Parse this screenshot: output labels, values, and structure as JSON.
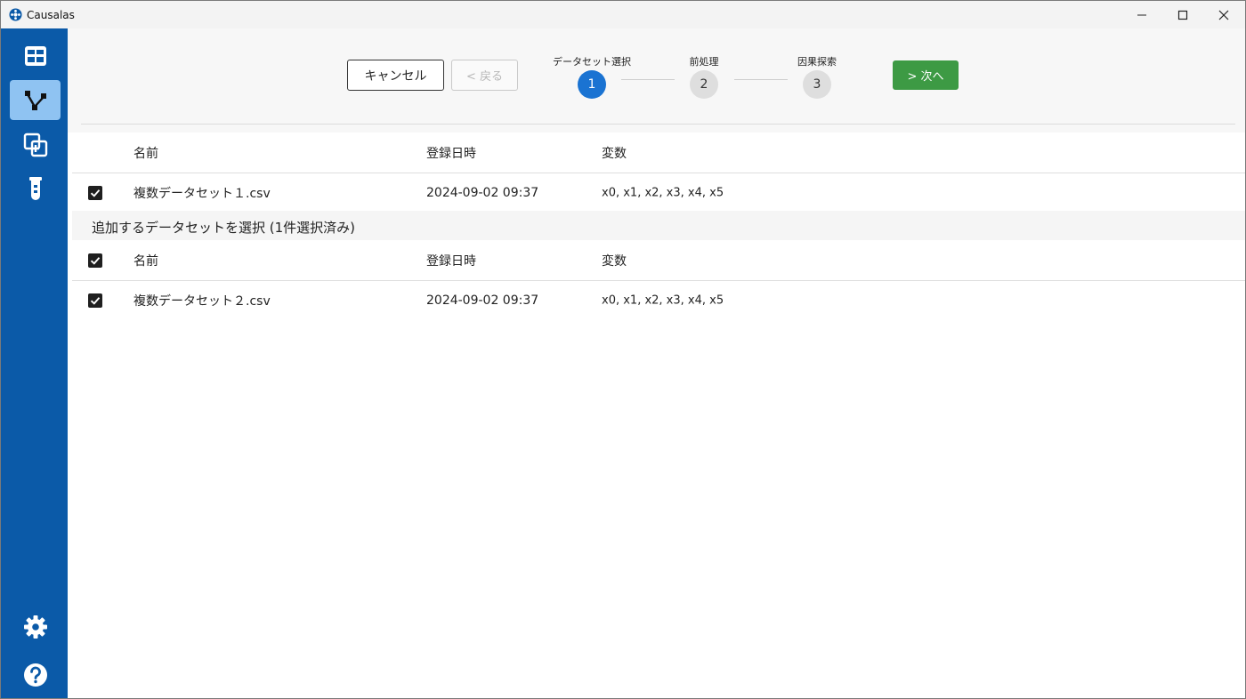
{
  "app": {
    "title": "Causalas"
  },
  "window_controls": {
    "minimize": "—",
    "maximize": "☐",
    "close": "✕"
  },
  "colors": {
    "sidebar": "#0b5aa8",
    "sidebar_active": "#8fc3f2",
    "step_active": "#1a73d2",
    "next_button": "#3d9a44"
  },
  "sidebar": {
    "items": [
      {
        "icon": "table-grid-icon",
        "active": false
      },
      {
        "icon": "causal-graph-icon",
        "active": true
      },
      {
        "icon": "compare-icon",
        "active": false
      },
      {
        "icon": "flask-icon",
        "active": false
      }
    ],
    "bottom": [
      {
        "icon": "gear-icon"
      },
      {
        "icon": "help-icon"
      }
    ]
  },
  "wizard": {
    "cancel_label": "キャンセル",
    "back_label": "< 戻る",
    "next_label": "> 次へ",
    "steps": [
      {
        "label": "データセット選択",
        "number": "1"
      },
      {
        "label": "前処理",
        "number": "2"
      },
      {
        "label": "因果探索",
        "number": "3"
      }
    ],
    "current_step": 1
  },
  "primary_table": {
    "headers": [
      "名前",
      "登録日時",
      "変数"
    ],
    "rows": [
      {
        "checked": true,
        "name": "複数データセット１.csv",
        "date": "2024-09-02 09:37",
        "vars": "x0, x1, x2, x3, x4, x5"
      }
    ]
  },
  "additional": {
    "title": "追加するデータセットを選択 (1件選択済み)",
    "select_all_checked": true,
    "headers": [
      "名前",
      "登録日時",
      "変数"
    ],
    "rows": [
      {
        "checked": true,
        "name": "複数データセット２.csv",
        "date": "2024-09-02 09:37",
        "vars": "x0, x1, x2, x3, x4, x5"
      }
    ]
  }
}
